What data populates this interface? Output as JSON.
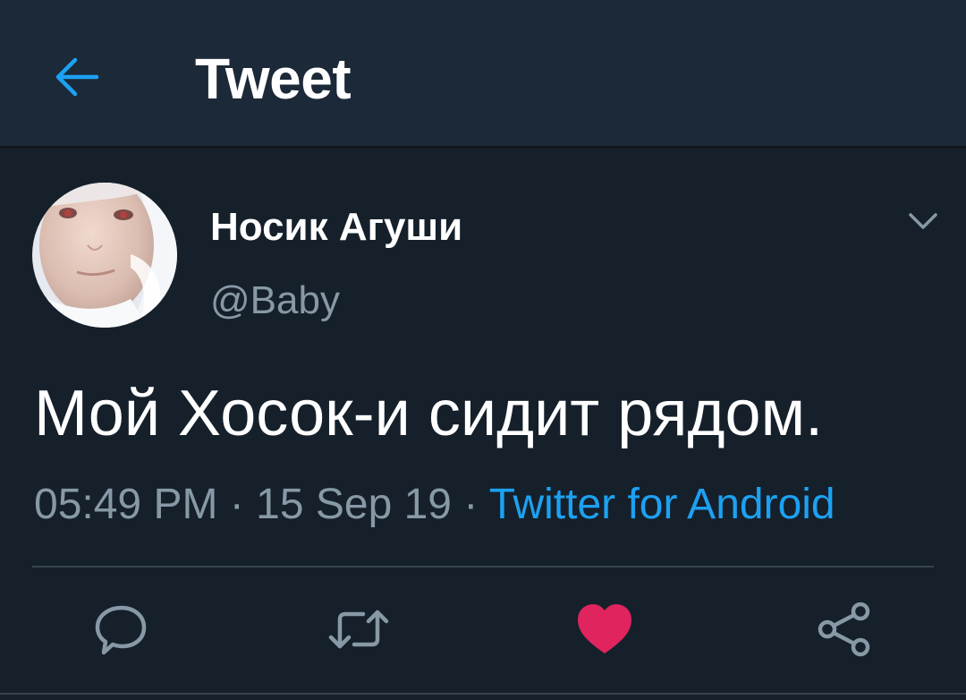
{
  "header": {
    "title": "Tweet",
    "back_icon": "arrow-left-icon"
  },
  "tweet": {
    "author": {
      "display_name": "Носик Агуши",
      "handle": "@Baby"
    },
    "text": "Мой Хосок-и сидит рядом.",
    "time": "05:49 PM",
    "date": "15 Sep 19",
    "separator": "·",
    "source": "Twitter for Android",
    "liked": true
  },
  "actions": [
    {
      "name": "reply",
      "icon": "speech-bubble-icon"
    },
    {
      "name": "retweet",
      "icon": "retweet-arrows-icon"
    },
    {
      "name": "like",
      "icon": "heart-icon"
    },
    {
      "name": "share",
      "icon": "share-icon"
    }
  ],
  "colors": {
    "background": "#15202b",
    "header_background": "#1c2938",
    "accent": "#1da1f2",
    "secondary_text": "#8899a6",
    "like": "#e0245e"
  }
}
